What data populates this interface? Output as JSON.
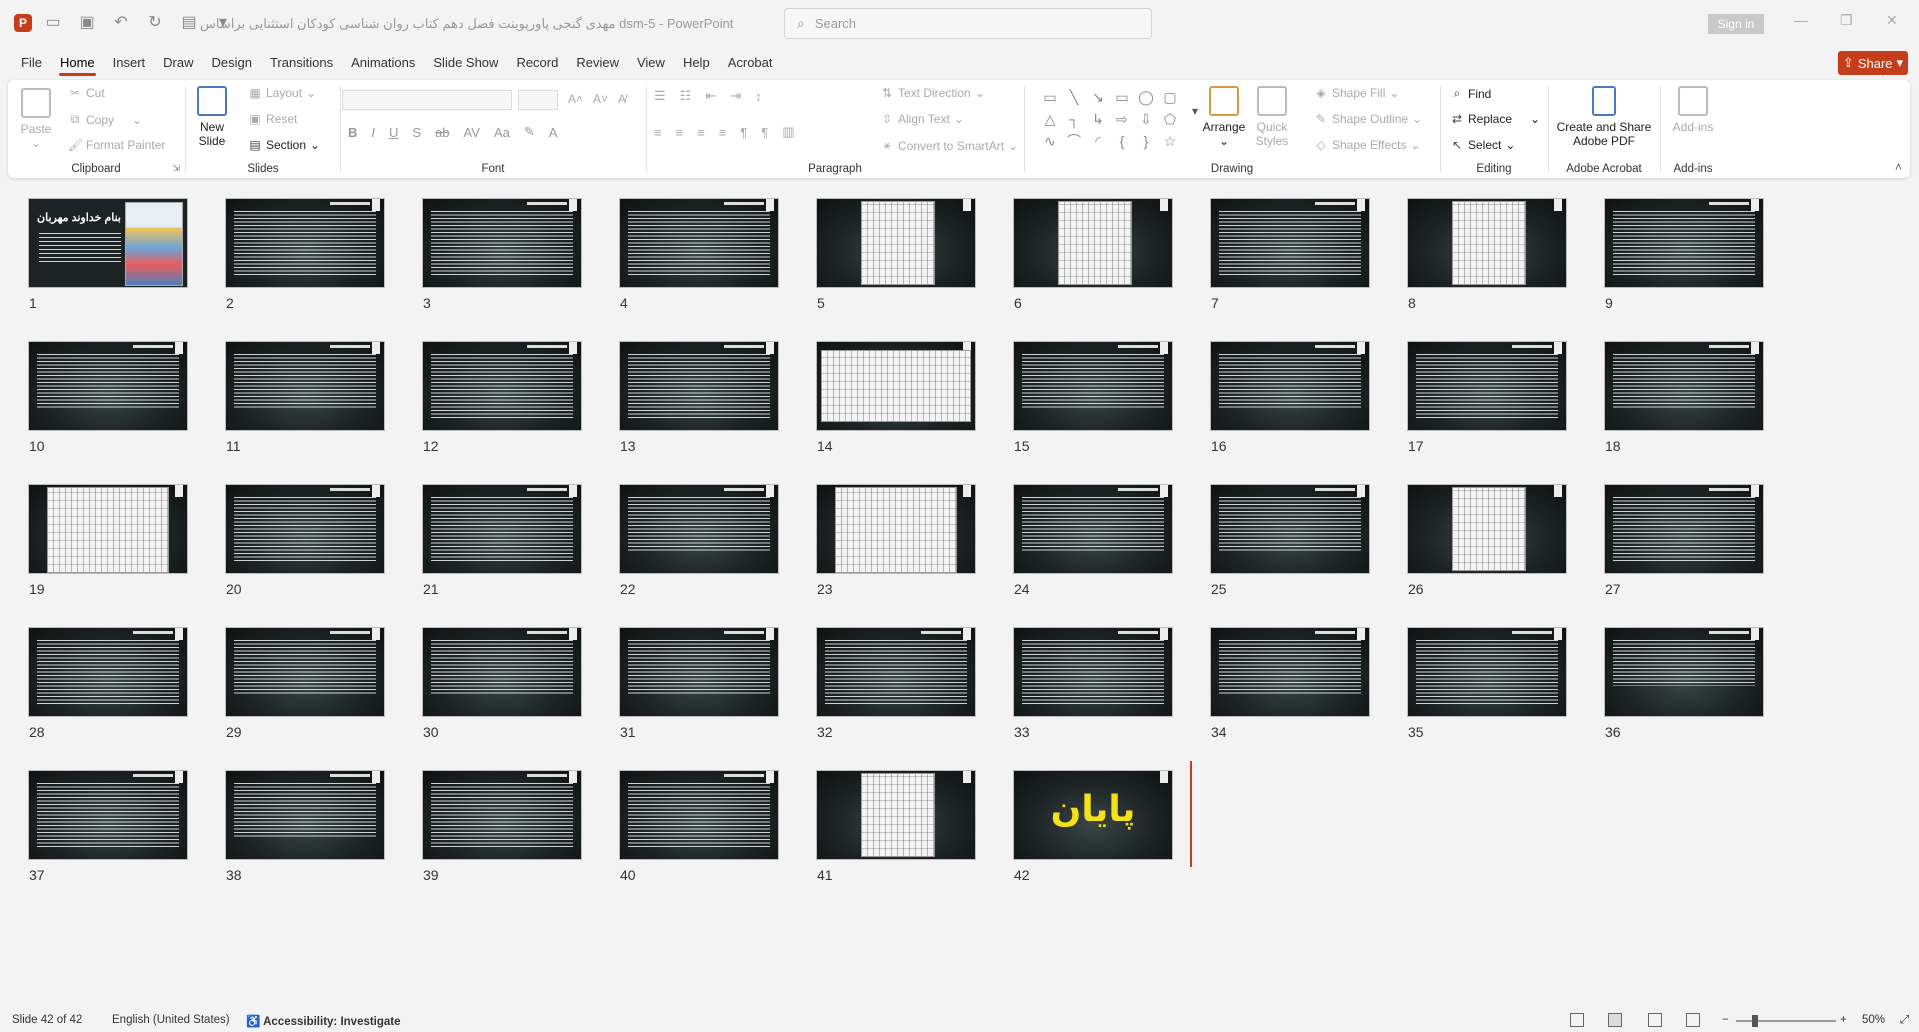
{
  "titlebar": {
    "app_letter": "P",
    "doc_title": "مهدی گنجی پاورپوینت فصل دهم کتاب روان شناسی کودکان استثنایی براساس dsm-5  -  PowerPoint",
    "search_placeholder": "Search",
    "sign_in": "Sign in"
  },
  "tabs": [
    "File",
    "Home",
    "Insert",
    "Draw",
    "Design",
    "Transitions",
    "Animations",
    "Slide Show",
    "Record",
    "Review",
    "View",
    "Help",
    "Acrobat"
  ],
  "active_tab": "Home",
  "share_label": "Share",
  "ribbon": {
    "clipboard": {
      "paste": "Paste",
      "cut": "Cut",
      "copy": "Copy",
      "format_painter": "Format Painter",
      "label": "Clipboard"
    },
    "slides": {
      "new_slide": "New Slide",
      "layout": "Layout",
      "reset": "Reset",
      "section": "Section",
      "label": "Slides"
    },
    "font": {
      "label": "Font",
      "bold": "B",
      "italic": "I",
      "underline": "U",
      "shadow": "S",
      "strike": "ab"
    },
    "paragraph": {
      "text_direction": "Text Direction",
      "align_text": "Align Text",
      "convert_smartart": "Convert to SmartArt",
      "label": "Paragraph"
    },
    "drawing": {
      "arrange": "Arrange",
      "quick_styles": "Quick Styles",
      "shape_fill": "Shape Fill",
      "shape_outline": "Shape Outline",
      "shape_effects": "Shape Effects",
      "label": "Drawing"
    },
    "editing": {
      "find": "Find",
      "replace": "Replace",
      "select": "Select",
      "label": "Editing"
    },
    "acrobat": {
      "create_share": "Create and Share Adobe PDF",
      "label": "Adobe Acrobat"
    },
    "addins": {
      "addins_btn": "Add-ins",
      "label": "Add-ins"
    }
  },
  "slides": [
    {
      "n": "1",
      "kind": "cover",
      "title": "بنام خداوند مهربان"
    },
    {
      "n": "2",
      "kind": "text"
    },
    {
      "n": "3",
      "kind": "text"
    },
    {
      "n": "4",
      "kind": "text"
    },
    {
      "n": "5",
      "kind": "picture"
    },
    {
      "n": "6",
      "kind": "picture"
    },
    {
      "n": "7",
      "kind": "text"
    },
    {
      "n": "8",
      "kind": "picture"
    },
    {
      "n": "9",
      "kind": "text"
    },
    {
      "n": "10",
      "kind": "text-mid"
    },
    {
      "n": "11",
      "kind": "text-mid"
    },
    {
      "n": "12",
      "kind": "text"
    },
    {
      "n": "13",
      "kind": "text"
    },
    {
      "n": "14",
      "kind": "picture-wide"
    },
    {
      "n": "15",
      "kind": "text-mid"
    },
    {
      "n": "16",
      "kind": "text-mid"
    },
    {
      "n": "17",
      "kind": "text"
    },
    {
      "n": "18",
      "kind": "text-mid"
    },
    {
      "n": "19",
      "kind": "picture-left"
    },
    {
      "n": "20",
      "kind": "text"
    },
    {
      "n": "21",
      "kind": "text"
    },
    {
      "n": "22",
      "kind": "text-mid"
    },
    {
      "n": "23",
      "kind": "picture-left"
    },
    {
      "n": "24",
      "kind": "text-mid"
    },
    {
      "n": "25",
      "kind": "text-mid"
    },
    {
      "n": "26",
      "kind": "picture"
    },
    {
      "n": "27",
      "kind": "text"
    },
    {
      "n": "28",
      "kind": "text"
    },
    {
      "n": "29",
      "kind": "text-mid"
    },
    {
      "n": "30",
      "kind": "text-mid"
    },
    {
      "n": "31",
      "kind": "text-mid"
    },
    {
      "n": "32",
      "kind": "text"
    },
    {
      "n": "33",
      "kind": "text"
    },
    {
      "n": "34",
      "kind": "text-mid"
    },
    {
      "n": "35",
      "kind": "text"
    },
    {
      "n": "36",
      "kind": "text-short"
    },
    {
      "n": "37",
      "kind": "text"
    },
    {
      "n": "38",
      "kind": "text-mid"
    },
    {
      "n": "39",
      "kind": "text"
    },
    {
      "n": "40",
      "kind": "text"
    },
    {
      "n": "41",
      "kind": "picture"
    },
    {
      "n": "42",
      "kind": "end",
      "title": "پایان"
    }
  ],
  "status": {
    "slide_pos": "Slide 42 of 42",
    "language": "English (United States)",
    "accessibility": "Accessibility: Investigate",
    "zoom": "50%"
  }
}
